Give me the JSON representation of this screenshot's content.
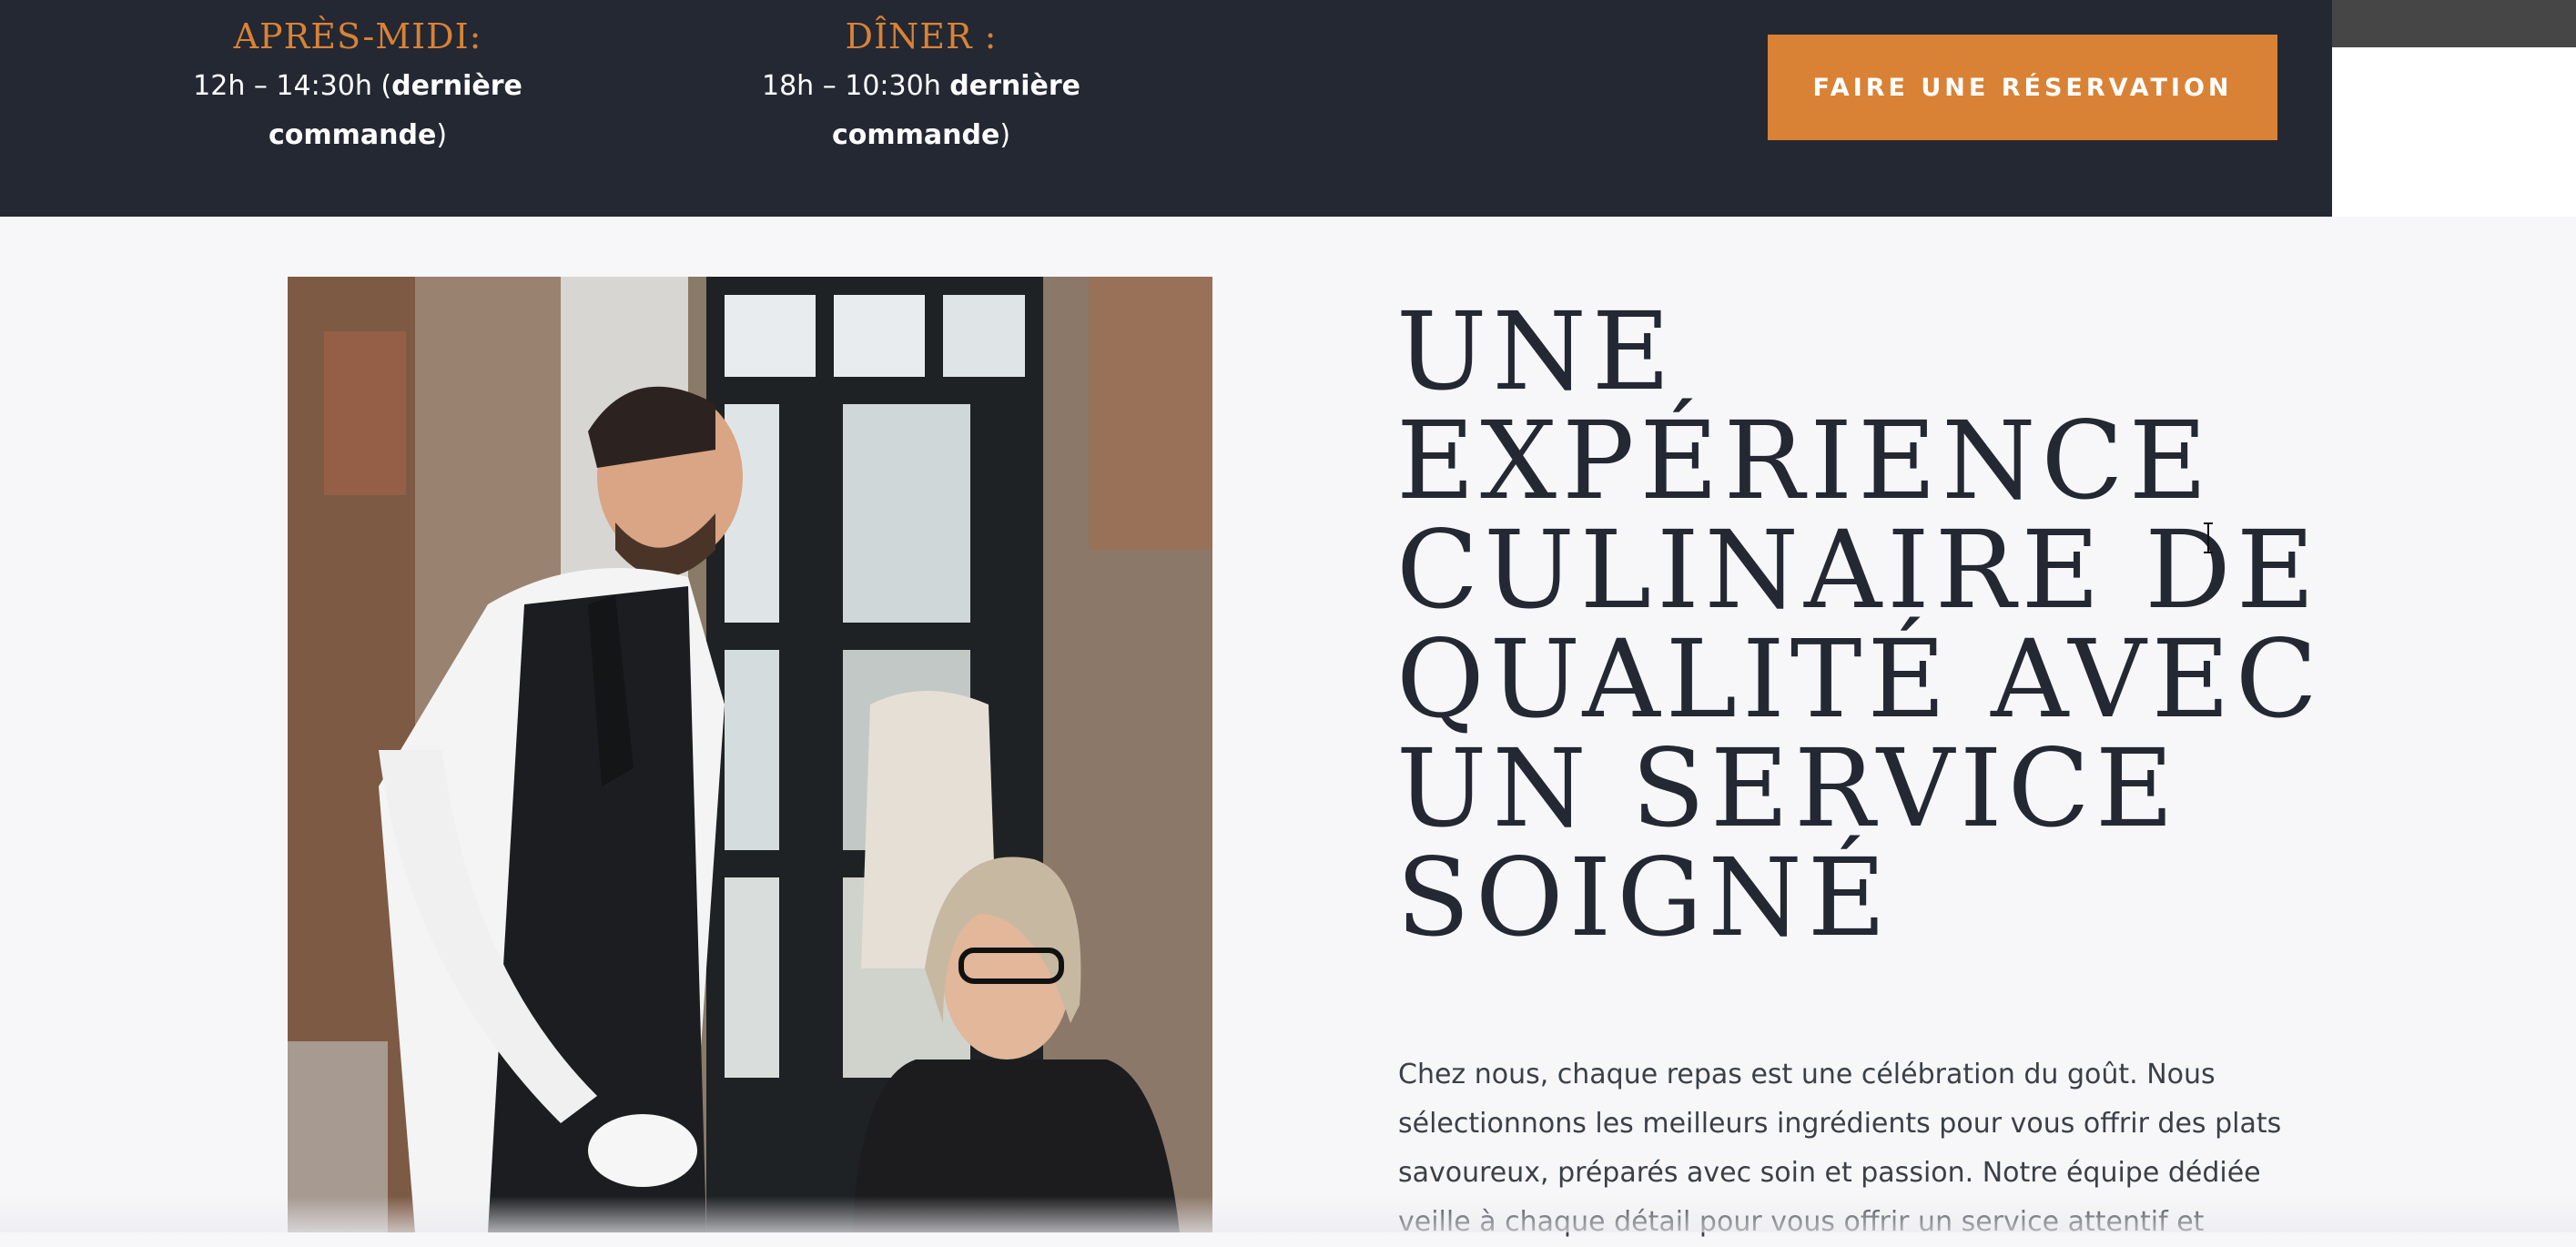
{
  "hours": {
    "lunch": {
      "title": "APRÈS-MIDI:",
      "time_prefix": "12h – 14:30h (",
      "bold": "dernière commande",
      "suffix": ")"
    },
    "dinner": {
      "title": "DÎNER :",
      "time_prefix": "18h – 10:30h ",
      "bold": "dernière commande",
      "suffix": ")"
    }
  },
  "reserve_button": {
    "label": "FAIRE UNE RÉSERVATION"
  },
  "hero": {
    "heading_lines": [
      "UNE",
      "EXPÉRIENCE",
      "CULINAIRE DE",
      "QUALITÉ AVEC",
      "UN SERVICE",
      "SOIGNÉ"
    ],
    "body": "Chez nous, chaque repas est une célébration du goût. Nous sélectionnons les meilleurs ingrédients pour vous offrir des plats savoureux, préparés avec soin et passion. Notre équipe dédiée veille à chaque détail pour vous offrir un service attentif et"
  },
  "colors": {
    "dark_bg": "#232833",
    "accent": "#d98235",
    "page_bg": "#f7f7f9"
  }
}
